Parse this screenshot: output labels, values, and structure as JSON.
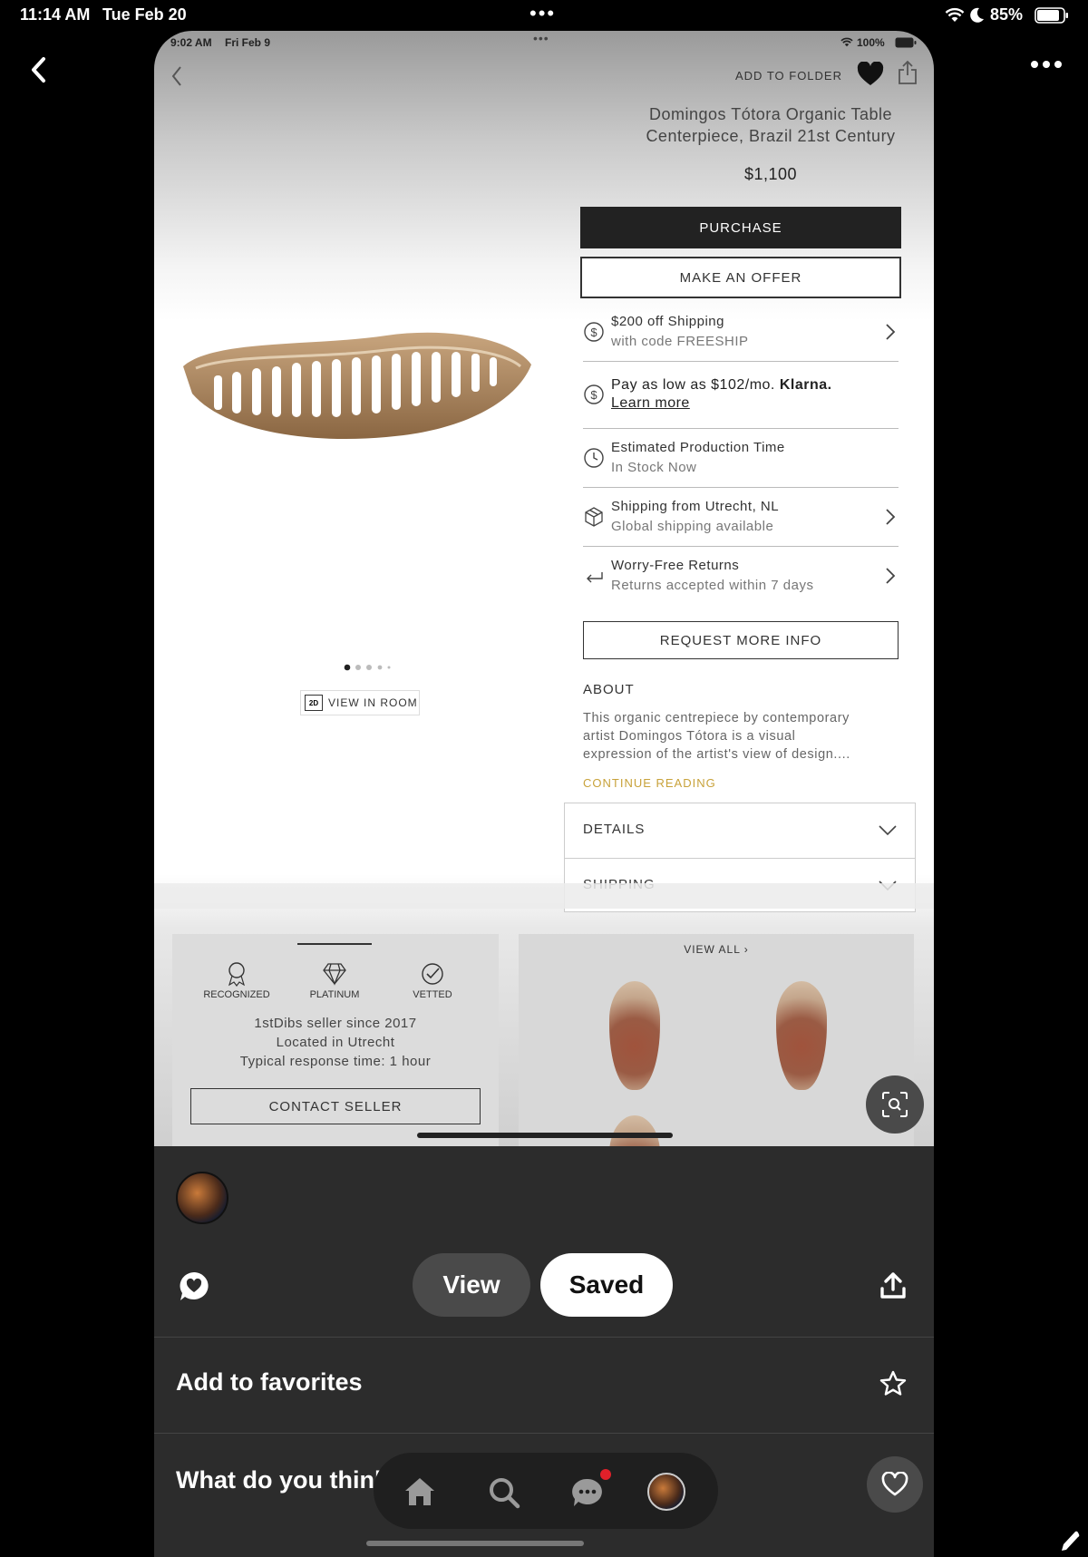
{
  "outer_status": {
    "time": "11:14 AM",
    "date": "Tue Feb 20",
    "battery": "85%"
  },
  "inner_status": {
    "time": "9:02 AM",
    "date": "Fri Feb 9",
    "battery": "100%"
  },
  "header": {
    "add_to_folder": "ADD TO FOLDER"
  },
  "product": {
    "title_line1": "Domingos Tótora Organic Table",
    "title_line2": "Centerpiece, Brazil 21st Century",
    "price": "$1,100",
    "purchase_label": "PURCHASE",
    "offer_label": "MAKE AN OFFER",
    "view_in_room": "VIEW IN ROOM",
    "badge_2d": "2D"
  },
  "info_rows": [
    {
      "title": "$200 off Shipping",
      "subtitle": "with code FREESHIP"
    },
    {
      "title": "Pay as low as $102/mo.",
      "brand": "Klarna.",
      "link": "Learn more"
    },
    {
      "title": "Estimated Production Time",
      "subtitle": "In Stock Now"
    },
    {
      "title": "Shipping from Utrecht, NL",
      "subtitle": "Global shipping available"
    },
    {
      "title": "Worry-Free Returns",
      "subtitle": "Returns accepted within 7 days"
    }
  ],
  "request_label": "REQUEST MORE INFO",
  "about": {
    "heading": "ABOUT",
    "line1": "This organic centrepiece by contemporary",
    "line2": "artist Domingos Tótora is a visual",
    "line3": "expression of the artist's view of design....",
    "continue": "CONTINUE READING"
  },
  "accordions": {
    "details": "DETAILS",
    "shipping": "SHIPPING"
  },
  "seller": {
    "badges": [
      "RECOGNIZED",
      "PLATINUM",
      "VETTED"
    ],
    "since": "1stDibs seller since 2017",
    "location": "Located in Utrecht",
    "response": "Typical response time: 1 hour",
    "contact_label": "CONTACT SELLER"
  },
  "more": {
    "view_all": "VIEW ALL"
  },
  "sheet": {
    "view_label": "View",
    "saved_label": "Saved",
    "favorites_label": "Add to favorites",
    "think_label": "What do you think?"
  },
  "colors": {
    "accent_gold": "#c8a23a",
    "notification": "#e0202a"
  }
}
